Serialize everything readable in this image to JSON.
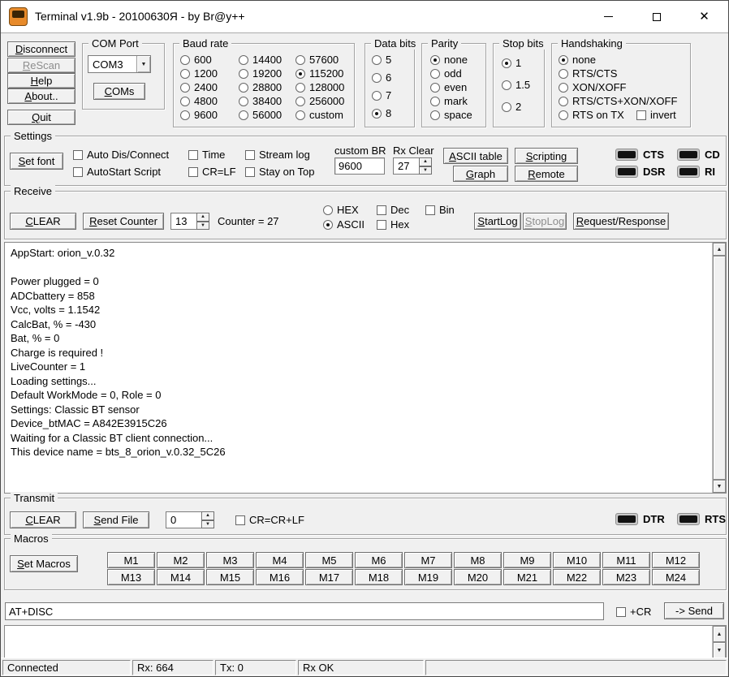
{
  "titlebar": {
    "title": "Terminal v1.9b - 20100630Я - by Br@y++"
  },
  "icons": {
    "close": "✕",
    "dropdown_arrow": "▼",
    "up_arrow": "▲",
    "down_arrow": "▼"
  },
  "connection_buttons": {
    "disconnect": "Disconnect",
    "rescan": "ReScan",
    "help": "Help",
    "about": "About..",
    "quit": "Quit"
  },
  "com_port": {
    "group_label": "COM Port",
    "selected_port": "COM3",
    "coms_button": "COMs"
  },
  "baud_rate": {
    "group_label": "Baud rate",
    "selected": "115200",
    "options": [
      "600",
      "1200",
      "2400",
      "4800",
      "9600",
      "14400",
      "19200",
      "28800",
      "38400",
      "56000",
      "57600",
      "115200",
      "128000",
      "256000",
      "custom"
    ]
  },
  "data_bits": {
    "group_label": "Data bits",
    "selected": "8",
    "options": [
      "5",
      "6",
      "7",
      "8"
    ]
  },
  "parity": {
    "group_label": "Parity",
    "selected": "none",
    "options": [
      "none",
      "odd",
      "even",
      "mark",
      "space"
    ]
  },
  "stop_bits": {
    "group_label": "Stop bits",
    "selected": "1",
    "options": [
      "1",
      "1.5",
      "2"
    ]
  },
  "handshaking": {
    "group_label": "Handshaking",
    "selected": "none",
    "options": [
      "none",
      "RTS/CTS",
      "XON/XOFF",
      "RTS/CTS+XON/XOFF",
      "RTS on TX"
    ],
    "invert_label": "invert",
    "invert_checked": false
  },
  "settings": {
    "group_label": "Settings",
    "set_font_button": "Set font",
    "checkboxes": {
      "auto_dis_connect": "Auto Dis/Connect",
      "autostart_script": "AutoStart Script",
      "time": "Time",
      "cr_lf": "CR=LF",
      "stream_log": "Stream log",
      "stay_on_top": "Stay on Top"
    },
    "custom_br_label": "custom BR",
    "custom_br_value": "9600",
    "rx_clear_label": "Rx Clear",
    "rx_clear_value": "27",
    "ascii_table_button": "ASCII table",
    "scripting_button": "Scripting",
    "graph_button": "Graph",
    "remote_button": "Remote",
    "leds": {
      "cts": "CTS",
      "dsr": "DSR",
      "cd": "CD",
      "ri": "RI"
    }
  },
  "receive": {
    "group_label": "Receive",
    "clear_button": "CLEAR",
    "reset_counter_button": "Reset Counter",
    "lines_value": "13",
    "counter_text": "Counter = 27",
    "hex_radio": "HEX",
    "ascii_radio": "ASCII",
    "mode_selected": "ASCII",
    "dec_checkbox": "Dec",
    "hex_checkbox": "Hex",
    "bin_checkbox": "Bin",
    "startlog_button": "StartLog",
    "stoplog_button": "StopLog",
    "request_response_button": "Request/Response",
    "terminal_text": "AppStart: orion_v.0.32\n\nPower plugged = 0\nADCbattery = 858\nVcc, volts = 1.1542\nCalcBat, % = -430\nBat, % = 0\nCharge is required !\nLiveCounter = 1\nLoading settings...\nDefault WorkMode = 0, Role = 0\nSettings: Classic BT sensor\nDevice_btMAC = A842E3915C26\nWaiting for a Classic BT client connection...\nThis device name = bts_8_orion_v.0.32_5C26"
  },
  "transmit": {
    "group_label": "Transmit",
    "clear_button": "CLEAR",
    "send_file_button": "Send File",
    "delay_value": "0",
    "cr_crlf_checkbox": "CR=CR+LF",
    "leds": {
      "dtr": "DTR",
      "rts": "RTS"
    }
  },
  "macros": {
    "group_label": "Macros",
    "set_macros_button": "Set Macros",
    "labels": [
      "M1",
      "M2",
      "M3",
      "M4",
      "M5",
      "M6",
      "M7",
      "M8",
      "M9",
      "M10",
      "M11",
      "M12",
      "M13",
      "M14",
      "M15",
      "M16",
      "M17",
      "M18",
      "M19",
      "M20",
      "M21",
      "M22",
      "M23",
      "M24"
    ]
  },
  "command": {
    "value": "AT+DISC",
    "plus_cr_checkbox": "+CR",
    "send_button": "-> Send"
  },
  "statusbar": {
    "connection": "Connected",
    "rx": "Rx: 664",
    "tx": "Tx: 0",
    "rx_status": "Rx OK"
  }
}
